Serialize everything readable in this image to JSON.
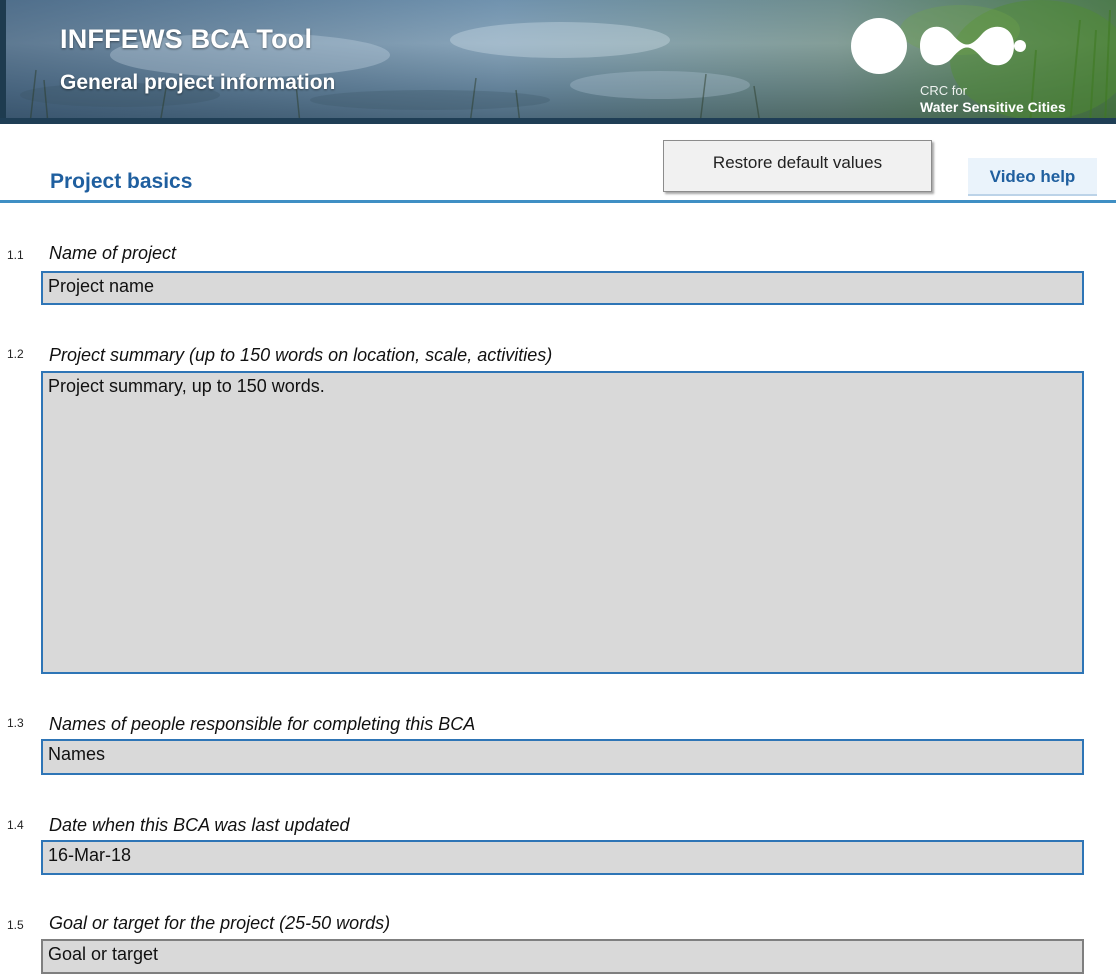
{
  "banner": {
    "title": "INFFEWS BCA Tool",
    "subtitle": "General project information",
    "logo_line1": "CRC for",
    "logo_line2": "Water Sensitive Cities"
  },
  "header": {
    "section_title": "Project basics",
    "restore_button_label": "Restore default values",
    "video_help_label": "Video help"
  },
  "fields": [
    {
      "number": "1.1",
      "label": "Name of project",
      "value": "Project name"
    },
    {
      "number": "1.2",
      "label": "Project summary (up to 150 words on location, scale, activities)",
      "value": "Project summary, up to 150 words."
    },
    {
      "number": "1.3",
      "label": "Names of people responsible for completing this BCA",
      "value": "Names"
    },
    {
      "number": "1.4",
      "label": "Date when this BCA was last updated",
      "value": "16-Mar-18"
    },
    {
      "number": "1.5",
      "label": "Goal or target for the project (25-50 words)",
      "value": "Goal or target"
    }
  ],
  "colors": {
    "accent_blue": "#2e75b6",
    "title_blue": "#1f5f9f",
    "input_fill": "#d9d9d9"
  }
}
